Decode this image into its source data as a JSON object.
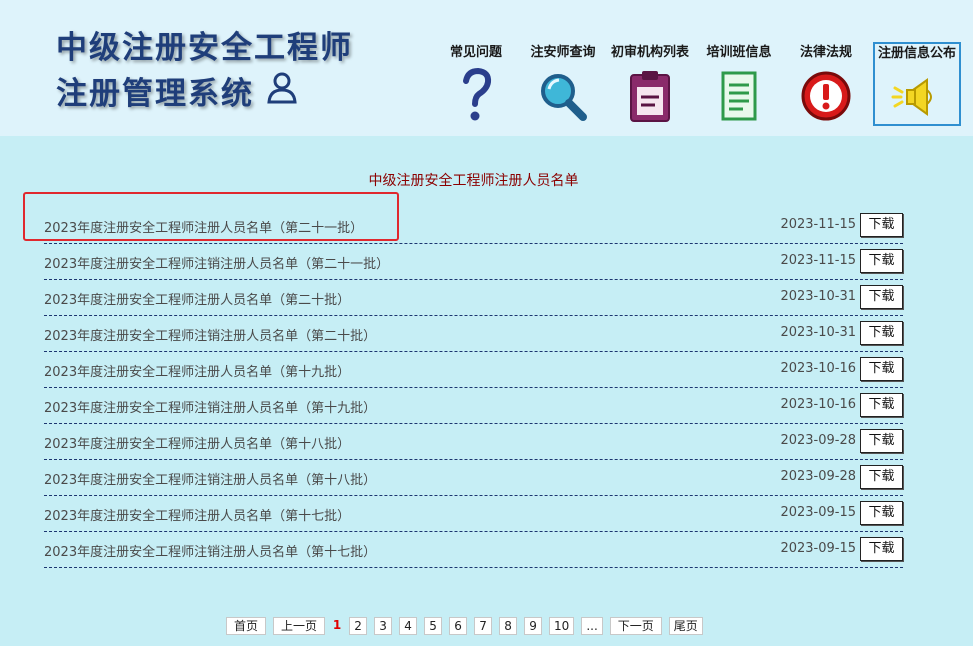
{
  "header": {
    "title_line1": "中级注册安全工程师",
    "title_line2": "注册管理系统",
    "nav": [
      {
        "label": "常见问题",
        "icon": "question-mark-icon"
      },
      {
        "label": "注安师查询",
        "icon": "magnifier-icon"
      },
      {
        "label": "初审机构列表",
        "icon": "clipboard-icon"
      },
      {
        "label": "培训班信息",
        "icon": "document-list-icon"
      },
      {
        "label": "法律法规",
        "icon": "warning-icon"
      },
      {
        "label": "注册信息公布",
        "icon": "megaphone-icon"
      }
    ],
    "active_nav": "注册信息公布"
  },
  "list": {
    "title": "中级注册安全工程师注册人员名单",
    "download_label": "下载",
    "items": [
      {
        "title": "2023年度注册安全工程师注册人员名单（第二十一批）",
        "date": "2023-11-15"
      },
      {
        "title": "2023年度注册安全工程师注销注册人员名单（第二十一批）",
        "date": "2023-11-15"
      },
      {
        "title": "2023年度注册安全工程师注册人员名单（第二十批）",
        "date": "2023-10-31"
      },
      {
        "title": "2023年度注册安全工程师注销注册人员名单（第二十批）",
        "date": "2023-10-31"
      },
      {
        "title": "2023年度注册安全工程师注册人员名单（第十九批）",
        "date": "2023-10-16"
      },
      {
        "title": "2023年度注册安全工程师注销注册人员名单（第十九批）",
        "date": "2023-10-16"
      },
      {
        "title": "2023年度注册安全工程师注册人员名单（第十八批）",
        "date": "2023-09-28"
      },
      {
        "title": "2023年度注册安全工程师注销注册人员名单（第十八批）",
        "date": "2023-09-28"
      },
      {
        "title": "2023年度注册安全工程师注册人员名单（第十七批）",
        "date": "2023-09-15"
      },
      {
        "title": "2023年度注册安全工程师注销注册人员名单（第十七批）",
        "date": "2023-09-15"
      }
    ]
  },
  "pagination": {
    "first": "首页",
    "prev": "上一页",
    "current": "1",
    "pages": [
      "2",
      "3",
      "4",
      "5",
      "6",
      "7",
      "8",
      "9",
      "10"
    ],
    "ellipsis": "...",
    "next": "下一页",
    "last": "尾页"
  },
  "colors": {
    "page_bg": "#c6eef5",
    "header_bg": "#def3fb",
    "title_color": "#1f3e7a",
    "list_title_color": "#8b0000",
    "highlight_border": "#e0282e",
    "current_page": "#e00000"
  }
}
